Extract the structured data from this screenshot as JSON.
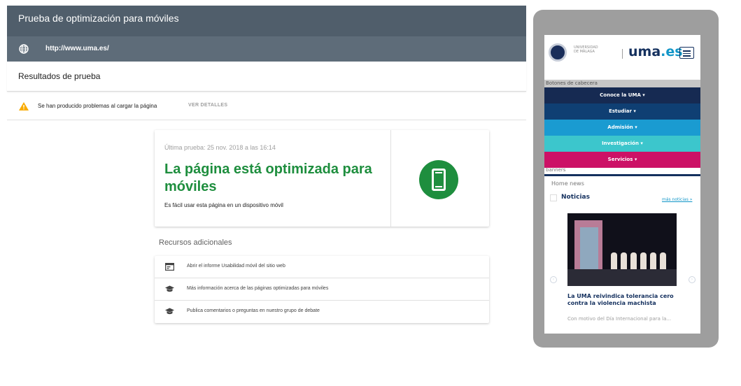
{
  "header": {
    "title": "Prueba de optimización para móviles",
    "url": "http://www.uma.es/"
  },
  "results": {
    "title": "Resultados de prueba"
  },
  "warning": {
    "text": "Se han producido problemas al cargar la página",
    "link": "VER DETALLES"
  },
  "result_card": {
    "last_test": "Última prueba: 25 nov. 2018 a las 16:14",
    "verdict": "La página está optimizada para móviles",
    "subtitle": "Es fácil usar esta página en un dispositivo móvil"
  },
  "resources": {
    "title": "Recursos adicionales",
    "items": [
      {
        "label": "Abrir el informe Usabilidad móvil del sitio web",
        "icon": "report-icon"
      },
      {
        "label": "Más información acerca de las páginas optimizadas para móviles",
        "icon": "graduation-cap-icon"
      },
      {
        "label": "Publica comentarios o preguntas en nuestro grupo de debate",
        "icon": "graduation-cap-icon"
      }
    ]
  },
  "preview": {
    "university": "UNIVERSIDAD DE MÁLAGA",
    "brand_main": "uma",
    "brand_suffix": ".es",
    "header_buttons_label": "Botones de cabecera",
    "nav": [
      {
        "label": "Conoce la UMA ▾",
        "color": "#162a52"
      },
      {
        "label": "Estudiar ▾",
        "color": "#0f3f73"
      },
      {
        "label": "Admisión ▾",
        "color": "#1a9bd1"
      },
      {
        "label": "Investigación ▾",
        "color": "#3cc6cc"
      },
      {
        "label": "Servicios ▾",
        "color": "#cc1166"
      }
    ],
    "banners_label": "banners",
    "home_news_label": "Home news",
    "news_title": "Noticias",
    "more_news": "más noticias »",
    "headline": "La UMA reivindica tolerancia cero contra la violencia machista",
    "snippet": "Con motivo del Día Internacional para la..."
  },
  "colors": {
    "header": "#505e6b",
    "success": "#1e8e3e",
    "brand": "#14305e"
  }
}
